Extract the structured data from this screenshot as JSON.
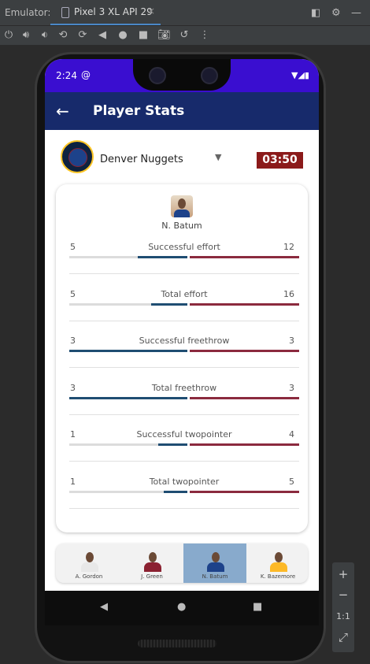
{
  "emulator": {
    "label": "Emulator:",
    "tab_title": "Pixel 3 XL API 29",
    "tab_close": "×",
    "zoom_label": "1:1"
  },
  "status_bar": {
    "time": "2:24",
    "at_icon": "@"
  },
  "app_bar": {
    "title": "Player Stats",
    "back_icon": "←"
  },
  "team": {
    "name": "Denver Nuggets",
    "timer": "03:50",
    "dropdown_icon": "▼"
  },
  "player": {
    "name": "N. Batum"
  },
  "stats": [
    {
      "label": "Successful effort",
      "left": "5",
      "right": "12",
      "left_fill": 0.42,
      "right_fill": 1.0
    },
    {
      "label": "Total effort",
      "left": "5",
      "right": "16",
      "left_fill": 0.31,
      "right_fill": 1.0
    },
    {
      "label": "Successful freethrow",
      "left": "3",
      "right": "3",
      "left_fill": 1.0,
      "right_fill": 1.0
    },
    {
      "label": "Total freethrow",
      "left": "3",
      "right": "3",
      "left_fill": 1.0,
      "right_fill": 1.0
    },
    {
      "label": "Successful twopointer",
      "left": "1",
      "right": "4",
      "left_fill": 0.25,
      "right_fill": 1.0
    },
    {
      "label": "Total twopointer",
      "left": "1",
      "right": "5",
      "left_fill": 0.2,
      "right_fill": 1.0
    }
  ],
  "roster": [
    {
      "name": "A. Gordon",
      "jersey_color": "#e8e8e8",
      "selected": false
    },
    {
      "name": "J. Green",
      "jersey_color": "#8b2131",
      "selected": false
    },
    {
      "name": "N. Batum",
      "jersey_color": "#1d428a",
      "selected": true
    },
    {
      "name": "K. Bazemore",
      "jersey_color": "#fdb927",
      "selected": false
    }
  ],
  "colors": {
    "app_bar": "#172a6b",
    "status_bar": "#3a0ed0",
    "timer_bg": "#8b1a1a",
    "left_bar": "#1f4d72",
    "right_bar": "#8b2a3e",
    "roster_selected": "#88aacc"
  }
}
